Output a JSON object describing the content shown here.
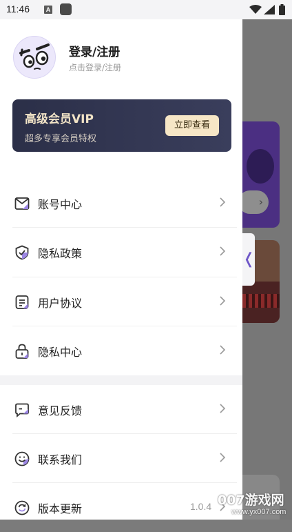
{
  "status_bar": {
    "time": "11:46",
    "a_badge": "A"
  },
  "profile": {
    "title": "登录/注册",
    "subtitle": "点击登录/注册"
  },
  "vip": {
    "title": "高级会员VIP",
    "subtitle": "超多专享会员特权",
    "button_label": "立即查看"
  },
  "menu_group1": [
    {
      "label": "账号中心",
      "icon": "mail-icon"
    },
    {
      "label": "隐私政策",
      "icon": "shield-check-icon"
    },
    {
      "label": "用户协议",
      "icon": "document-icon"
    },
    {
      "label": "隐私中心",
      "icon": "lock-icon"
    }
  ],
  "menu_group2": [
    {
      "label": "意见反馈",
      "icon": "feedback-icon"
    },
    {
      "label": "联系我们",
      "icon": "smile-icon"
    },
    {
      "label": "版本更新",
      "icon": "refresh-icon",
      "value": "1.0.4"
    }
  ],
  "background_app": {
    "handle_glyph": "❬"
  },
  "watermark": {
    "line1": "007游戏网",
    "line2": "www.yx007.com"
  },
  "colors": {
    "accent": "#6e56c8",
    "vip_bg": "#2b2f48",
    "vip_text": "#f1e3c6",
    "vip_button": "#f6e6c6"
  }
}
